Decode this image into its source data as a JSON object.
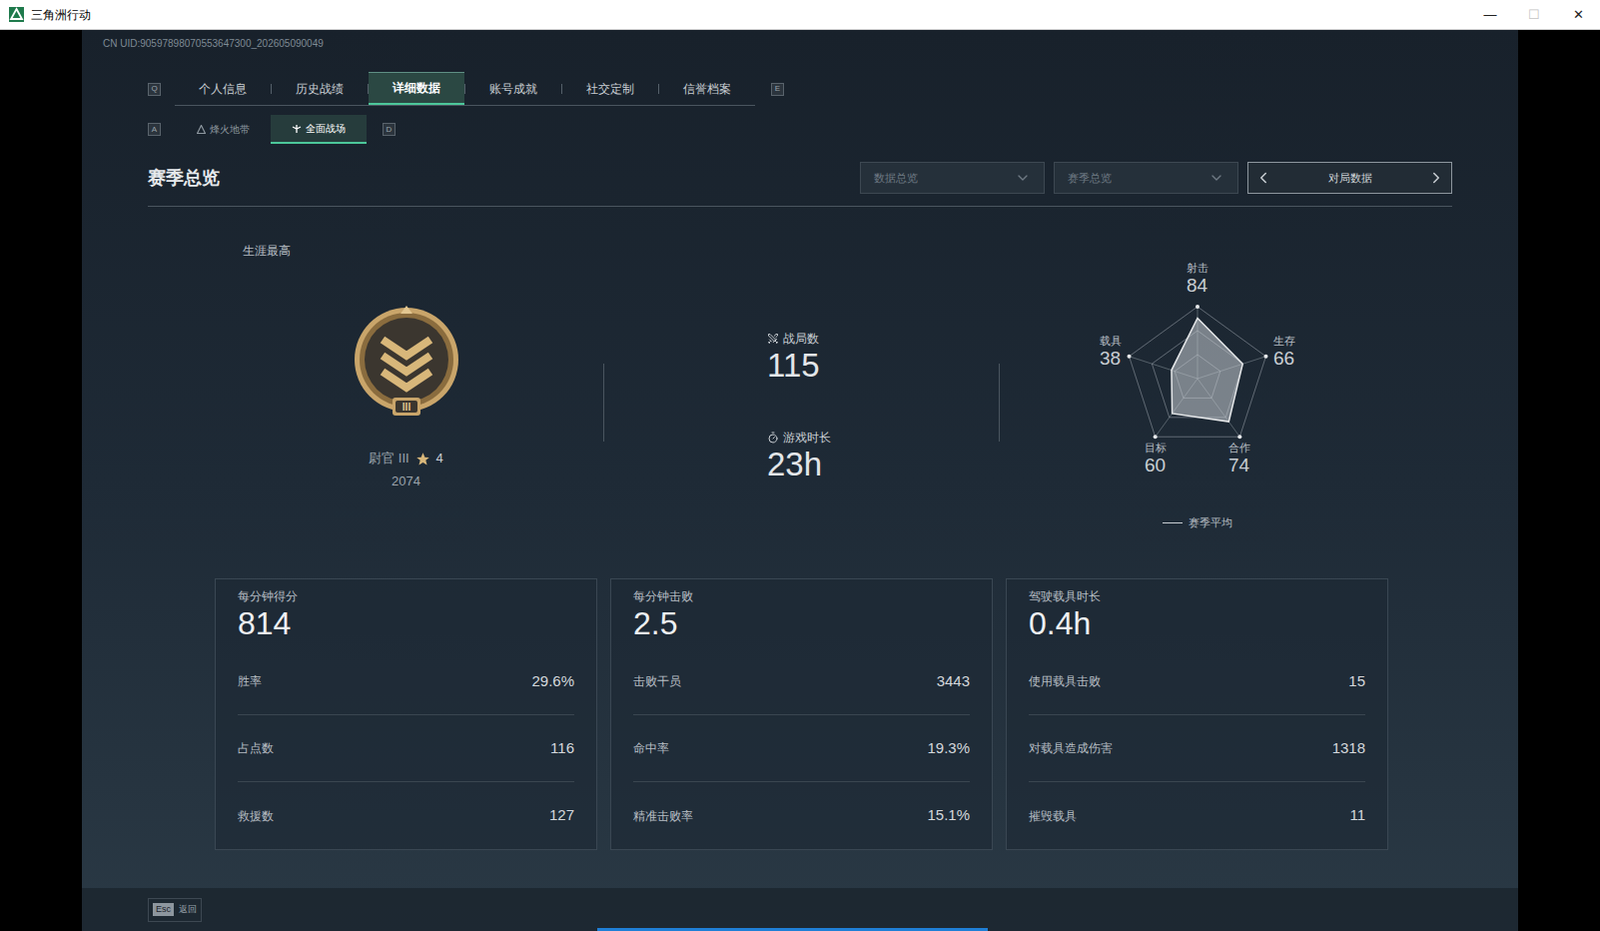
{
  "window": {
    "title": "三角洲行动",
    "controls": [
      {
        "glyph": "—",
        "disabled": false
      },
      {
        "glyph": "☐",
        "disabled": true
      },
      {
        "glyph": "✕",
        "disabled": false
      }
    ]
  },
  "uid": "CN UID:90597898070553647300_202605090049",
  "tabs": {
    "prev_key": "Q",
    "next_key": "E",
    "items": [
      {
        "label": "个人信息",
        "selected": false
      },
      {
        "label": "历史战绩",
        "selected": false
      },
      {
        "label": "详细数据",
        "selected": true
      },
      {
        "label": "账号成就",
        "selected": false
      },
      {
        "label": "社交定制",
        "selected": false
      },
      {
        "label": "信誉档案",
        "selected": false
      }
    ]
  },
  "subtabs": {
    "prev_key": "A",
    "next_key": "D",
    "items": [
      {
        "label": "烽火地带",
        "selected": false
      },
      {
        "label": "全面战场",
        "selected": true
      }
    ]
  },
  "section": {
    "title": "赛季总览",
    "filters": [
      {
        "label": "数据总览"
      },
      {
        "label": "赛季总览"
      }
    ],
    "pager": {
      "label": "对局数据"
    }
  },
  "career": {
    "label": "生涯最高",
    "badge_numeral": "III",
    "rank": "尉官 III",
    "rank_stars": "4",
    "score": "2074"
  },
  "stats": [
    {
      "kind": "count",
      "label": "战局数",
      "value": "115"
    },
    {
      "kind": "duration",
      "label": "游戏时长",
      "value": "23h"
    }
  ],
  "radar": {
    "axes": [
      "射击",
      "生存",
      "合作",
      "目标",
      "载具"
    ],
    "values": [
      84,
      66,
      74,
      60,
      38
    ],
    "value_labels": [
      "84",
      "66",
      "74",
      "60",
      "38"
    ],
    "legend": "赛季平均"
  },
  "cards": [
    {
      "title": "每分钟得分",
      "value": "814",
      "rows": [
        {
          "label": "胜率",
          "value": "29.6%"
        },
        {
          "label": "占点数",
          "value": "116"
        },
        {
          "label": "救援数",
          "value": "127"
        }
      ]
    },
    {
      "title": "每分钟击败",
      "value": "2.5",
      "rows": [
        {
          "label": "击败干员",
          "value": "3443"
        },
        {
          "label": "命中率",
          "value": "19.3%"
        },
        {
          "label": "精准击败率",
          "value": "15.1%"
        }
      ]
    },
    {
      "title": "驾驶载具时长",
      "value": "0.4h",
      "rows": [
        {
          "label": "使用载具击败",
          "value": "15"
        },
        {
          "label": "对载具造成伤害",
          "value": "1318"
        },
        {
          "label": "摧毁载具",
          "value": "11"
        }
      ]
    }
  ],
  "footer": {
    "key": "Esc",
    "label": "返回"
  }
}
